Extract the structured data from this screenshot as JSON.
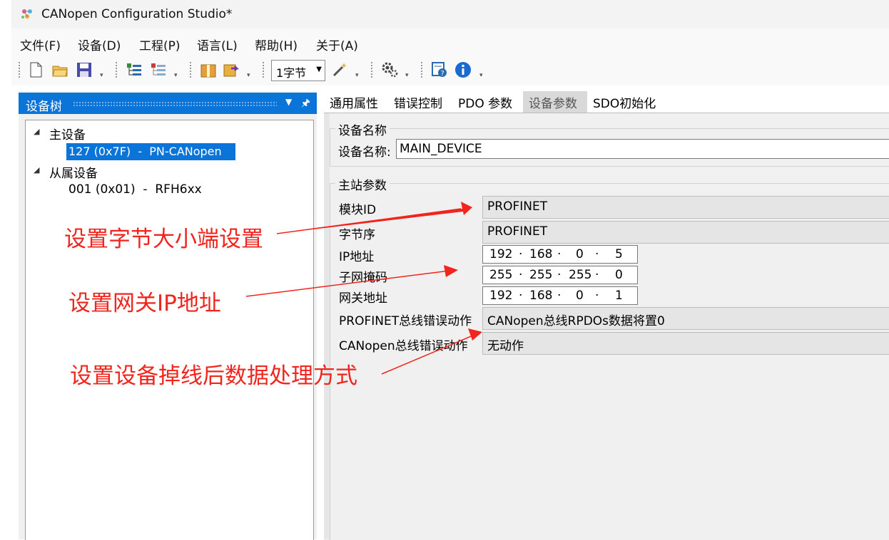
{
  "window": {
    "title": "CANopen Configuration Studio*"
  },
  "menu": {
    "items": [
      {
        "label": "文件(F)"
      },
      {
        "label": "设备(D)"
      },
      {
        "label": "工程(P)"
      },
      {
        "label": "语言(L)"
      },
      {
        "label": "帮助(H)"
      },
      {
        "label": "关于(A)"
      }
    ]
  },
  "toolbar": {
    "byte_select_value": "1字节",
    "icons": [
      "new-file-icon",
      "open-folder-icon",
      "save-icon",
      "add-device-icon",
      "remove-device-icon",
      "package-icon",
      "export-icon",
      "wand-icon",
      "settings-icon",
      "help-doc-icon",
      "info-icon"
    ]
  },
  "device_tree": {
    "title": "设备树",
    "master_group": "主设备",
    "master_node": "127 (0x7F)  -  PN-CANopen",
    "slave_group": "从属设备",
    "slave_node": "001 (0x01)  -  RFH6xx"
  },
  "tabs": [
    {
      "label": "通用属性"
    },
    {
      "label": "错误控制"
    },
    {
      "label": "PDO 参数"
    },
    {
      "label": "设备参数",
      "active": true
    },
    {
      "label": "SDO初始化"
    }
  ],
  "device_name_group": {
    "title": "设备名称",
    "label": "设备名称:",
    "value": "MAIN_DEVICE"
  },
  "master_params": {
    "title": "主站参数",
    "module_id": {
      "label": "模块ID",
      "value": "PROFINET"
    },
    "byte_order": {
      "label": "字节序",
      "value": "PROFINET"
    },
    "ip_address": {
      "label": "IP地址",
      "octets": [
        "192",
        "168",
        "0",
        "5"
      ]
    },
    "subnet_mask": {
      "label": "子网掩码",
      "octets": [
        "255",
        "255",
        "255",
        "0"
      ]
    },
    "gateway": {
      "label": "网关地址",
      "octets": [
        "192",
        "168",
        "0",
        "1"
      ]
    },
    "profinet_error": {
      "label": "PROFINET总线错误动作",
      "value": "CANopen总线RPDOs数据将置0"
    },
    "canopen_error": {
      "label": "CANopen总线错误动作",
      "value": "无动作"
    }
  },
  "annotations": {
    "a1": "设置字节大小端设置",
    "a2": "设置网关IP地址",
    "a3": "设置设备掉线后数据处理方式",
    "color": "#f0251d"
  },
  "colors": {
    "accent": "#0a74d8"
  }
}
